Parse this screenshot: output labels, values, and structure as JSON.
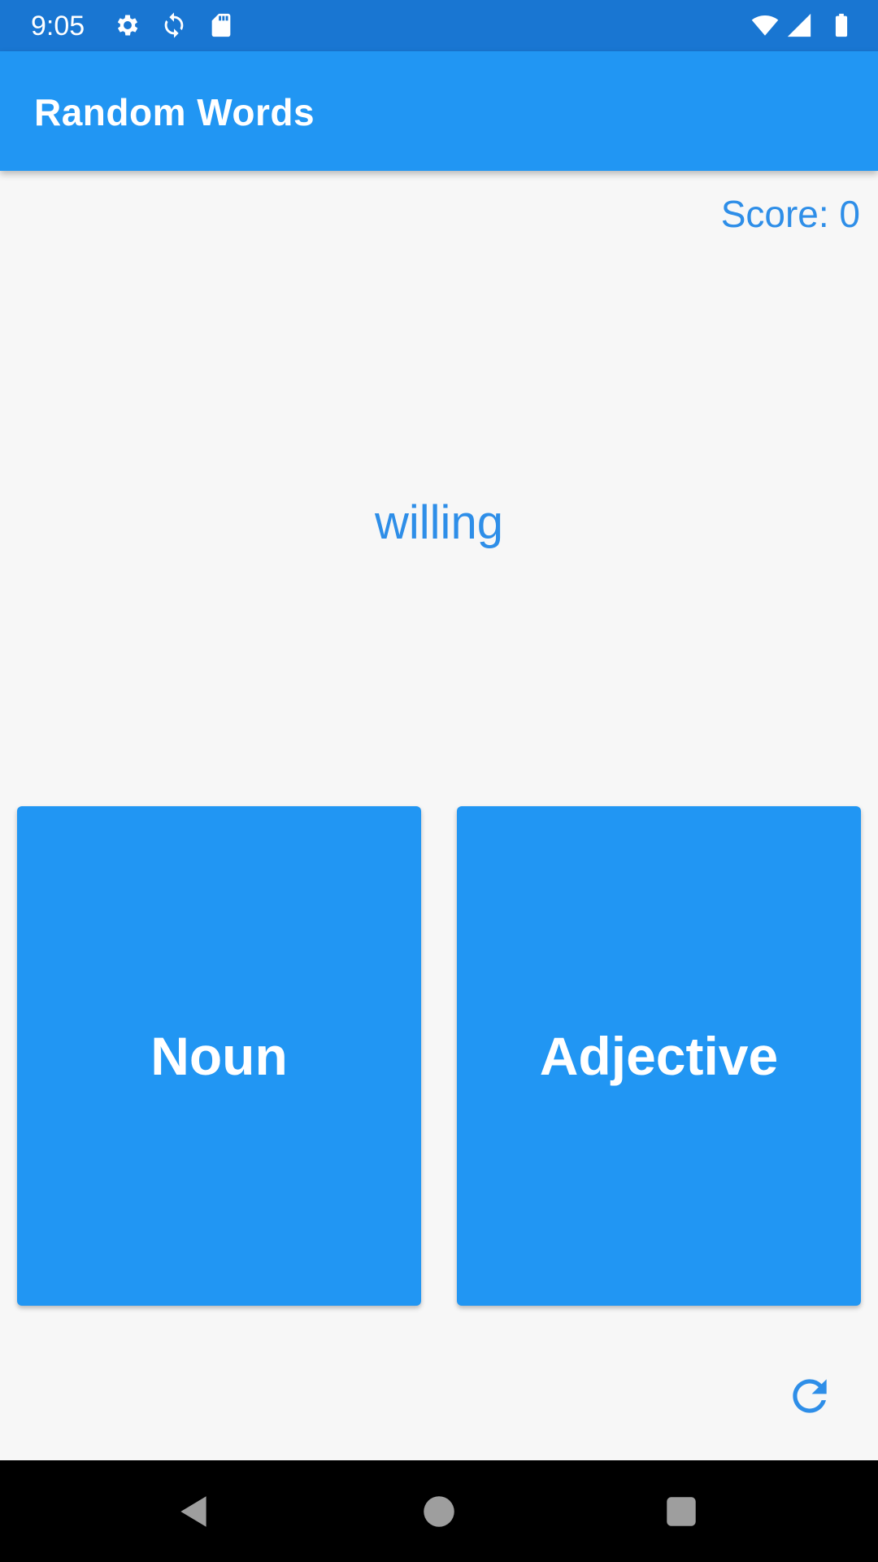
{
  "status_bar": {
    "time": "9:05",
    "icons": [
      "settings-icon",
      "sync-icon",
      "sd-card-icon",
      "wifi-icon",
      "signal-icon",
      "battery-icon"
    ]
  },
  "app_bar": {
    "title": "Random Words"
  },
  "game": {
    "score_label": "Score: 0",
    "word": "willing",
    "buttons": {
      "noun": "Noun",
      "adjective": "Adjective"
    },
    "refresh_icon": "refresh-icon"
  },
  "nav_bar": {
    "icons": [
      "back-icon",
      "home-icon",
      "recents-icon"
    ]
  },
  "colors": {
    "primary": "#2196f3",
    "primary_dark": "#1976d2",
    "accent_text": "#2e8ee8",
    "background": "#f7f7f7"
  }
}
